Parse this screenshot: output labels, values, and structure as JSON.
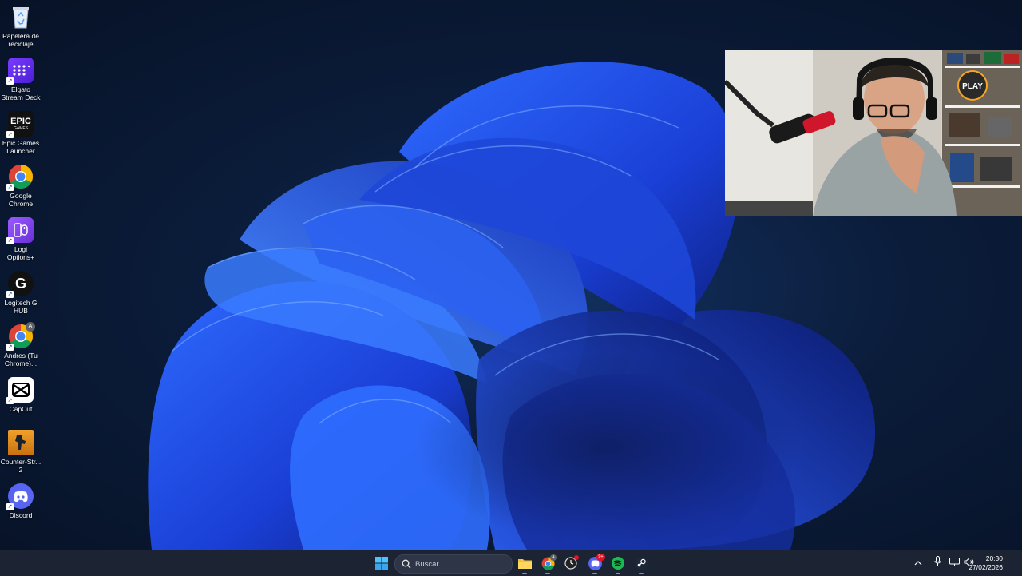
{
  "desktop": {
    "icons": [
      {
        "label_line1": "Papelera de",
        "label_line2": "reciclaje",
        "icon": "recycle-bin-icon"
      },
      {
        "label_line1": "Elgato",
        "label_line2": "Stream Deck",
        "icon": "stream-deck-icon"
      },
      {
        "label_line1": "Epic Games",
        "label_line2": "Launcher",
        "icon": "epic-games-icon",
        "logo_text": "EPIC",
        "logo_sub": "GAMES"
      },
      {
        "label_line1": "Google",
        "label_line2": "Chrome",
        "icon": "chrome-icon"
      },
      {
        "label_line1": "Logi",
        "label_line2": "Options+",
        "icon": "logi-options-icon"
      },
      {
        "label_line1": "Logitech G",
        "label_line2": "HUB",
        "icon": "logitech-g-hub-icon",
        "logo_text": "G"
      },
      {
        "label_line1": "Andres (Tu",
        "label_line2": "Chrome)...",
        "icon": "chrome-profile-icon",
        "logo_text": "A"
      },
      {
        "label_line1": "CapCut",
        "label_line2": "",
        "icon": "capcut-icon"
      },
      {
        "label_line1": "Counter-Str...",
        "label_line2": "2",
        "icon": "counter-strike-icon"
      },
      {
        "label_line1": "Discord",
        "label_line2": "",
        "icon": "discord-icon"
      }
    ]
  },
  "webcam": {
    "sign_text": "PLAY"
  },
  "taskbar": {
    "search_placeholder": "Buscar",
    "apps": [
      "start-icon",
      "file-explorer-icon",
      "chrome-icon",
      "clock-app-icon",
      "discord-icon",
      "spotify-icon",
      "steam-icon"
    ],
    "discord_badge": "9+",
    "chrome_badge": "A"
  },
  "tray": {
    "time": "20:30",
    "date": "27/02/2026"
  },
  "colors": {
    "taskbar": "#1c2433",
    "accent": "#3a7bff",
    "spotify": "#1db954",
    "discord": "#5865f2"
  }
}
